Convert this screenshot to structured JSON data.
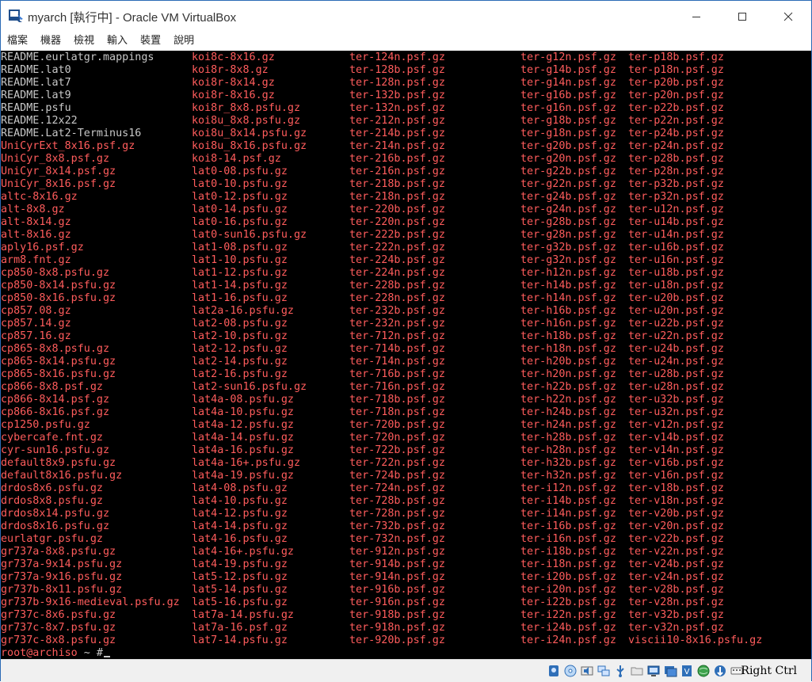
{
  "window": {
    "title": "myarch [執行中] - Oracle VM VirtualBox",
    "app_icon": "virtualbox-icon",
    "controls": [
      "minimize-icon",
      "maximize-icon",
      "close-icon"
    ]
  },
  "menubar": {
    "items": [
      {
        "label": "檔案"
      },
      {
        "label": "機器"
      },
      {
        "label": "檢視"
      },
      {
        "label": "輸入"
      },
      {
        "label": "裝置"
      },
      {
        "label": "說明"
      }
    ]
  },
  "terminal": {
    "colors": {
      "background": "#000000",
      "default": "#c8c8c8",
      "archive": "#ff5c5c"
    },
    "columns": [
      [
        {
          "t": "README.eurlatgr.mappings",
          "c": "white"
        },
        {
          "t": "README.lat0",
          "c": "white"
        },
        {
          "t": "README.lat7",
          "c": "white"
        },
        {
          "t": "README.lat9",
          "c": "white"
        },
        {
          "t": "README.psfu",
          "c": "white"
        },
        {
          "t": "README.12x22",
          "c": "white"
        },
        {
          "t": "README.Lat2-Terminus16",
          "c": "white"
        },
        {
          "t": "UniCyrExt_8x16.psf.gz",
          "c": "red"
        },
        {
          "t": "UniCyr_8x8.psf.gz",
          "c": "red"
        },
        {
          "t": "UniCyr_8x14.psf.gz",
          "c": "red"
        },
        {
          "t": "UniCyr_8x16.psf.gz",
          "c": "red"
        },
        {
          "t": "altc-8x16.gz",
          "c": "red"
        },
        {
          "t": "alt-8x8.gz",
          "c": "red"
        },
        {
          "t": "alt-8x14.gz",
          "c": "red"
        },
        {
          "t": "alt-8x16.gz",
          "c": "red"
        },
        {
          "t": "aply16.psf.gz",
          "c": "red"
        },
        {
          "t": "arm8.fnt.gz",
          "c": "red"
        },
        {
          "t": "cp850-8x8.psfu.gz",
          "c": "red"
        },
        {
          "t": "cp850-8x14.psfu.gz",
          "c": "red"
        },
        {
          "t": "cp850-8x16.psfu.gz",
          "c": "red"
        },
        {
          "t": "cp857.08.gz",
          "c": "red"
        },
        {
          "t": "cp857.14.gz",
          "c": "red"
        },
        {
          "t": "cp857.16.gz",
          "c": "red"
        },
        {
          "t": "cp865-8x8.psfu.gz",
          "c": "red"
        },
        {
          "t": "cp865-8x14.psfu.gz",
          "c": "red"
        },
        {
          "t": "cp865-8x16.psfu.gz",
          "c": "red"
        },
        {
          "t": "cp866-8x8.psf.gz",
          "c": "red"
        },
        {
          "t": "cp866-8x14.psf.gz",
          "c": "red"
        },
        {
          "t": "cp866-8x16.psf.gz",
          "c": "red"
        },
        {
          "t": "cp1250.psfu.gz",
          "c": "red"
        },
        {
          "t": "cybercafe.fnt.gz",
          "c": "red"
        },
        {
          "t": "cyr-sun16.psfu.gz",
          "c": "red"
        },
        {
          "t": "default8x9.psfu.gz",
          "c": "red"
        },
        {
          "t": "default8x16.psfu.gz",
          "c": "red"
        },
        {
          "t": "drdos8x6.psfu.gz",
          "c": "red"
        },
        {
          "t": "drdos8x8.psfu.gz",
          "c": "red"
        },
        {
          "t": "drdos8x14.psfu.gz",
          "c": "red"
        },
        {
          "t": "drdos8x16.psfu.gz",
          "c": "red"
        },
        {
          "t": "eurlatgr.psfu.gz",
          "c": "red"
        },
        {
          "t": "gr737a-8x8.psfu.gz",
          "c": "red"
        },
        {
          "t": "gr737a-9x14.psfu.gz",
          "c": "red"
        },
        {
          "t": "gr737a-9x16.psfu.gz",
          "c": "red"
        },
        {
          "t": "gr737b-8x11.psfu.gz",
          "c": "red"
        },
        {
          "t": "gr737b-9x16-medieval.psfu.gz",
          "c": "red"
        },
        {
          "t": "gr737c-8x6.psfu.gz",
          "c": "red"
        },
        {
          "t": "gr737c-8x7.psfu.gz",
          "c": "red"
        },
        {
          "t": "gr737c-8x8.psfu.gz",
          "c": "red"
        }
      ],
      [
        {
          "t": "koi8c-8x16.gz",
          "c": "red"
        },
        {
          "t": "koi8r-8x8.gz",
          "c": "red"
        },
        {
          "t": "koi8r-8x14.gz",
          "c": "red"
        },
        {
          "t": "koi8r-8x16.gz",
          "c": "red"
        },
        {
          "t": "koi8r_8x8.psfu.gz",
          "c": "red"
        },
        {
          "t": "koi8u_8x8.psfu.gz",
          "c": "red"
        },
        {
          "t": "koi8u_8x14.psfu.gz",
          "c": "red"
        },
        {
          "t": "koi8u_8x16.psfu.gz",
          "c": "red"
        },
        {
          "t": "koi8-14.psf.gz",
          "c": "red"
        },
        {
          "t": "lat0-08.psfu.gz",
          "c": "red"
        },
        {
          "t": "lat0-10.psfu.gz",
          "c": "red"
        },
        {
          "t": "lat0-12.psfu.gz",
          "c": "red"
        },
        {
          "t": "lat0-14.psfu.gz",
          "c": "red"
        },
        {
          "t": "lat0-16.psfu.gz",
          "c": "red"
        },
        {
          "t": "lat0-sun16.psfu.gz",
          "c": "red"
        },
        {
          "t": "lat1-08.psfu.gz",
          "c": "red"
        },
        {
          "t": "lat1-10.psfu.gz",
          "c": "red"
        },
        {
          "t": "lat1-12.psfu.gz",
          "c": "red"
        },
        {
          "t": "lat1-14.psfu.gz",
          "c": "red"
        },
        {
          "t": "lat1-16.psfu.gz",
          "c": "red"
        },
        {
          "t": "lat2a-16.psfu.gz",
          "c": "red"
        },
        {
          "t": "lat2-08.psfu.gz",
          "c": "red"
        },
        {
          "t": "lat2-10.psfu.gz",
          "c": "red"
        },
        {
          "t": "lat2-12.psfu.gz",
          "c": "red"
        },
        {
          "t": "lat2-14.psfu.gz",
          "c": "red"
        },
        {
          "t": "lat2-16.psfu.gz",
          "c": "red"
        },
        {
          "t": "lat2-sun16.psfu.gz",
          "c": "red"
        },
        {
          "t": "lat4a-08.psfu.gz",
          "c": "red"
        },
        {
          "t": "lat4a-10.psfu.gz",
          "c": "red"
        },
        {
          "t": "lat4a-12.psfu.gz",
          "c": "red"
        },
        {
          "t": "lat4a-14.psfu.gz",
          "c": "red"
        },
        {
          "t": "lat4a-16.psfu.gz",
          "c": "red"
        },
        {
          "t": "lat4a-16+.psfu.gz",
          "c": "red"
        },
        {
          "t": "lat4a-19.psfu.gz",
          "c": "red"
        },
        {
          "t": "lat4-08.psfu.gz",
          "c": "red"
        },
        {
          "t": "lat4-10.psfu.gz",
          "c": "red"
        },
        {
          "t": "lat4-12.psfu.gz",
          "c": "red"
        },
        {
          "t": "lat4-14.psfu.gz",
          "c": "red"
        },
        {
          "t": "lat4-16.psfu.gz",
          "c": "red"
        },
        {
          "t": "lat4-16+.psfu.gz",
          "c": "red"
        },
        {
          "t": "lat4-19.psfu.gz",
          "c": "red"
        },
        {
          "t": "lat5-12.psfu.gz",
          "c": "red"
        },
        {
          "t": "lat5-14.psfu.gz",
          "c": "red"
        },
        {
          "t": "lat5-16.psfu.gz",
          "c": "red"
        },
        {
          "t": "lat7a-14.psfu.gz",
          "c": "red"
        },
        {
          "t": "lat7a-16.psf.gz",
          "c": "red"
        },
        {
          "t": "lat7-14.psfu.gz",
          "c": "red"
        }
      ],
      [
        {
          "t": "ter-124n.psf.gz",
          "c": "red"
        },
        {
          "t": "ter-128b.psf.gz",
          "c": "red"
        },
        {
          "t": "ter-128n.psf.gz",
          "c": "red"
        },
        {
          "t": "ter-132b.psf.gz",
          "c": "red"
        },
        {
          "t": "ter-132n.psf.gz",
          "c": "red"
        },
        {
          "t": "ter-212n.psf.gz",
          "c": "red"
        },
        {
          "t": "ter-214b.psf.gz",
          "c": "red"
        },
        {
          "t": "ter-214n.psf.gz",
          "c": "red"
        },
        {
          "t": "ter-216b.psf.gz",
          "c": "red"
        },
        {
          "t": "ter-216n.psf.gz",
          "c": "red"
        },
        {
          "t": "ter-218b.psf.gz",
          "c": "red"
        },
        {
          "t": "ter-218n.psf.gz",
          "c": "red"
        },
        {
          "t": "ter-220b.psf.gz",
          "c": "red"
        },
        {
          "t": "ter-220n.psf.gz",
          "c": "red"
        },
        {
          "t": "ter-222b.psf.gz",
          "c": "red"
        },
        {
          "t": "ter-222n.psf.gz",
          "c": "red"
        },
        {
          "t": "ter-224b.psf.gz",
          "c": "red"
        },
        {
          "t": "ter-224n.psf.gz",
          "c": "red"
        },
        {
          "t": "ter-228b.psf.gz",
          "c": "red"
        },
        {
          "t": "ter-228n.psf.gz",
          "c": "red"
        },
        {
          "t": "ter-232b.psf.gz",
          "c": "red"
        },
        {
          "t": "ter-232n.psf.gz",
          "c": "red"
        },
        {
          "t": "ter-712n.psf.gz",
          "c": "red"
        },
        {
          "t": "ter-714b.psf.gz",
          "c": "red"
        },
        {
          "t": "ter-714n.psf.gz",
          "c": "red"
        },
        {
          "t": "ter-716b.psf.gz",
          "c": "red"
        },
        {
          "t": "ter-716n.psf.gz",
          "c": "red"
        },
        {
          "t": "ter-718b.psf.gz",
          "c": "red"
        },
        {
          "t": "ter-718n.psf.gz",
          "c": "red"
        },
        {
          "t": "ter-720b.psf.gz",
          "c": "red"
        },
        {
          "t": "ter-720n.psf.gz",
          "c": "red"
        },
        {
          "t": "ter-722b.psf.gz",
          "c": "red"
        },
        {
          "t": "ter-722n.psf.gz",
          "c": "red"
        },
        {
          "t": "ter-724b.psf.gz",
          "c": "red"
        },
        {
          "t": "ter-724n.psf.gz",
          "c": "red"
        },
        {
          "t": "ter-728b.psf.gz",
          "c": "red"
        },
        {
          "t": "ter-728n.psf.gz",
          "c": "red"
        },
        {
          "t": "ter-732b.psf.gz",
          "c": "red"
        },
        {
          "t": "ter-732n.psf.gz",
          "c": "red"
        },
        {
          "t": "ter-912n.psf.gz",
          "c": "red"
        },
        {
          "t": "ter-914b.psf.gz",
          "c": "red"
        },
        {
          "t": "ter-914n.psf.gz",
          "c": "red"
        },
        {
          "t": "ter-916b.psf.gz",
          "c": "red"
        },
        {
          "t": "ter-916n.psf.gz",
          "c": "red"
        },
        {
          "t": "ter-918b.psf.gz",
          "c": "red"
        },
        {
          "t": "ter-918n.psf.gz",
          "c": "red"
        },
        {
          "t": "ter-920b.psf.gz",
          "c": "red"
        }
      ],
      [
        {
          "t": "ter-g12n.psf.gz",
          "c": "red"
        },
        {
          "t": "ter-g14b.psf.gz",
          "c": "red"
        },
        {
          "t": "ter-g14n.psf.gz",
          "c": "red"
        },
        {
          "t": "ter-g16b.psf.gz",
          "c": "red"
        },
        {
          "t": "ter-g16n.psf.gz",
          "c": "red"
        },
        {
          "t": "ter-g18b.psf.gz",
          "c": "red"
        },
        {
          "t": "ter-g18n.psf.gz",
          "c": "red"
        },
        {
          "t": "ter-g20b.psf.gz",
          "c": "red"
        },
        {
          "t": "ter-g20n.psf.gz",
          "c": "red"
        },
        {
          "t": "ter-g22b.psf.gz",
          "c": "red"
        },
        {
          "t": "ter-g22n.psf.gz",
          "c": "red"
        },
        {
          "t": "ter-g24b.psf.gz",
          "c": "red"
        },
        {
          "t": "ter-g24n.psf.gz",
          "c": "red"
        },
        {
          "t": "ter-g28b.psf.gz",
          "c": "red"
        },
        {
          "t": "ter-g28n.psf.gz",
          "c": "red"
        },
        {
          "t": "ter-g32b.psf.gz",
          "c": "red"
        },
        {
          "t": "ter-g32n.psf.gz",
          "c": "red"
        },
        {
          "t": "ter-h12n.psf.gz",
          "c": "red"
        },
        {
          "t": "ter-h14b.psf.gz",
          "c": "red"
        },
        {
          "t": "ter-h14n.psf.gz",
          "c": "red"
        },
        {
          "t": "ter-h16b.psf.gz",
          "c": "red"
        },
        {
          "t": "ter-h16n.psf.gz",
          "c": "red"
        },
        {
          "t": "ter-h18b.psf.gz",
          "c": "red"
        },
        {
          "t": "ter-h18n.psf.gz",
          "c": "red"
        },
        {
          "t": "ter-h20b.psf.gz",
          "c": "red"
        },
        {
          "t": "ter-h20n.psf.gz",
          "c": "red"
        },
        {
          "t": "ter-h22b.psf.gz",
          "c": "red"
        },
        {
          "t": "ter-h22n.psf.gz",
          "c": "red"
        },
        {
          "t": "ter-h24b.psf.gz",
          "c": "red"
        },
        {
          "t": "ter-h24n.psf.gz",
          "c": "red"
        },
        {
          "t": "ter-h28b.psf.gz",
          "c": "red"
        },
        {
          "t": "ter-h28n.psf.gz",
          "c": "red"
        },
        {
          "t": "ter-h32b.psf.gz",
          "c": "red"
        },
        {
          "t": "ter-h32n.psf.gz",
          "c": "red"
        },
        {
          "t": "ter-i12n.psf.gz",
          "c": "red"
        },
        {
          "t": "ter-i14b.psf.gz",
          "c": "red"
        },
        {
          "t": "ter-i14n.psf.gz",
          "c": "red"
        },
        {
          "t": "ter-i16b.psf.gz",
          "c": "red"
        },
        {
          "t": "ter-i16n.psf.gz",
          "c": "red"
        },
        {
          "t": "ter-i18b.psf.gz",
          "c": "red"
        },
        {
          "t": "ter-i18n.psf.gz",
          "c": "red"
        },
        {
          "t": "ter-i20b.psf.gz",
          "c": "red"
        },
        {
          "t": "ter-i20n.psf.gz",
          "c": "red"
        },
        {
          "t": "ter-i22b.psf.gz",
          "c": "red"
        },
        {
          "t": "ter-i22n.psf.gz",
          "c": "red"
        },
        {
          "t": "ter-i24b.psf.gz",
          "c": "red"
        },
        {
          "t": "ter-i24n.psf.gz",
          "c": "red"
        }
      ],
      [
        {
          "t": "ter-p18b.psf.gz",
          "c": "red"
        },
        {
          "t": "ter-p18n.psf.gz",
          "c": "red"
        },
        {
          "t": "ter-p20b.psf.gz",
          "c": "red"
        },
        {
          "t": "ter-p20n.psf.gz",
          "c": "red"
        },
        {
          "t": "ter-p22b.psf.gz",
          "c": "red"
        },
        {
          "t": "ter-p22n.psf.gz",
          "c": "red"
        },
        {
          "t": "ter-p24b.psf.gz",
          "c": "red"
        },
        {
          "t": "ter-p24n.psf.gz",
          "c": "red"
        },
        {
          "t": "ter-p28b.psf.gz",
          "c": "red"
        },
        {
          "t": "ter-p28n.psf.gz",
          "c": "red"
        },
        {
          "t": "ter-p32b.psf.gz",
          "c": "red"
        },
        {
          "t": "ter-p32n.psf.gz",
          "c": "red"
        },
        {
          "t": "ter-u12n.psf.gz",
          "c": "red"
        },
        {
          "t": "ter-u14b.psf.gz",
          "c": "red"
        },
        {
          "t": "ter-u14n.psf.gz",
          "c": "red"
        },
        {
          "t": "ter-u16b.psf.gz",
          "c": "red"
        },
        {
          "t": "ter-u16n.psf.gz",
          "c": "red"
        },
        {
          "t": "ter-u18b.psf.gz",
          "c": "red"
        },
        {
          "t": "ter-u18n.psf.gz",
          "c": "red"
        },
        {
          "t": "ter-u20b.psf.gz",
          "c": "red"
        },
        {
          "t": "ter-u20n.psf.gz",
          "c": "red"
        },
        {
          "t": "ter-u22b.psf.gz",
          "c": "red"
        },
        {
          "t": "ter-u22n.psf.gz",
          "c": "red"
        },
        {
          "t": "ter-u24b.psf.gz",
          "c": "red"
        },
        {
          "t": "ter-u24n.psf.gz",
          "c": "red"
        },
        {
          "t": "ter-u28b.psf.gz",
          "c": "red"
        },
        {
          "t": "ter-u28n.psf.gz",
          "c": "red"
        },
        {
          "t": "ter-u32b.psf.gz",
          "c": "red"
        },
        {
          "t": "ter-u32n.psf.gz",
          "c": "red"
        },
        {
          "t": "ter-v12n.psf.gz",
          "c": "red"
        },
        {
          "t": "ter-v14b.psf.gz",
          "c": "red"
        },
        {
          "t": "ter-v14n.psf.gz",
          "c": "red"
        },
        {
          "t": "ter-v16b.psf.gz",
          "c": "red"
        },
        {
          "t": "ter-v16n.psf.gz",
          "c": "red"
        },
        {
          "t": "ter-v18b.psf.gz",
          "c": "red"
        },
        {
          "t": "ter-v18n.psf.gz",
          "c": "red"
        },
        {
          "t": "ter-v20b.psf.gz",
          "c": "red"
        },
        {
          "t": "ter-v20n.psf.gz",
          "c": "red"
        },
        {
          "t": "ter-v22b.psf.gz",
          "c": "red"
        },
        {
          "t": "ter-v22n.psf.gz",
          "c": "red"
        },
        {
          "t": "ter-v24b.psf.gz",
          "c": "red"
        },
        {
          "t": "ter-v24n.psf.gz",
          "c": "red"
        },
        {
          "t": "ter-v28b.psf.gz",
          "c": "red"
        },
        {
          "t": "ter-v28n.psf.gz",
          "c": "red"
        },
        {
          "t": "ter-v32b.psf.gz",
          "c": "red"
        },
        {
          "t": "ter-v32n.psf.gz",
          "c": "red"
        },
        {
          "t": "viscii10-8x16.psfu.gz",
          "c": "red"
        }
      ]
    ],
    "prompt": {
      "user_host": "root@archiso",
      "rest": " ~ #"
    }
  },
  "statusbar": {
    "icons": [
      "hard-disk-icon",
      "optical-drive-icon",
      "audio-icon",
      "network-icon",
      "usb-icon",
      "shared-folder-icon",
      "display-icon",
      "recording-icon",
      "virtualization-icon",
      "globe-icon",
      "mouse-integration-icon",
      "keyboard-capture-icon"
    ],
    "host_key": "Right Ctrl"
  }
}
